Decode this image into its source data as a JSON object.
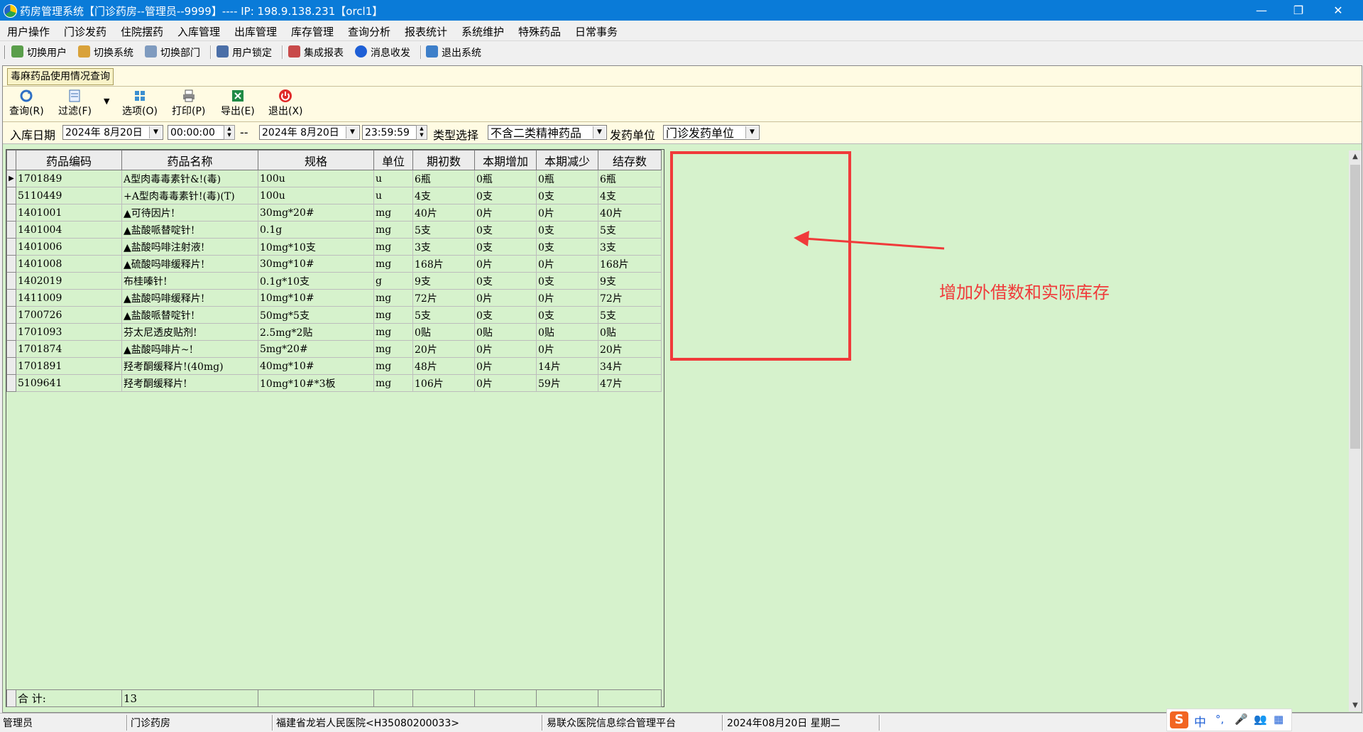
{
  "window": {
    "title": "药房管理系统【门诊药房--管理员--9999】---- IP: 198.9.138.231【orcl1】",
    "minimize": "—",
    "restore": "❐",
    "close": "✕"
  },
  "menu": [
    "用户操作",
    "门诊发药",
    "住院摆药",
    "入库管理",
    "出库管理",
    "库存管理",
    "查询分析",
    "报表统计",
    "系统维护",
    "特殊药品",
    "日常事务"
  ],
  "toolbar": [
    "切换用户",
    "切换系统",
    "切换部门",
    "用户锁定",
    "集成报表",
    "消息收发",
    "退出系统"
  ],
  "tab": {
    "label": "毒麻药品使用情况查询"
  },
  "actions": [
    "查询(R)",
    "过滤(F)",
    "选项(O)",
    "打印(P)",
    "导出(E)",
    "退出(X)"
  ],
  "filter": {
    "date_label": "入库日期",
    "start_date": "2024年 8月20日",
    "start_time": "00:00:00",
    "separator": "--",
    "end_date": "2024年 8月20日",
    "end_time": "23:59:59",
    "type_label": "类型选择",
    "type_value": "不含二类精神药品",
    "unit_label": "发药单位",
    "unit_value": "门诊发药单位"
  },
  "table": {
    "columns": [
      "药品编码",
      "药品名称",
      "规格",
      "单位",
      "期初数",
      "本期增加",
      "本期减少",
      "结存数"
    ],
    "rows": [
      [
        "1701849",
        "A型肉毒毒素针&!(毒)",
        "100u",
        "u",
        "6瓶",
        "0瓶",
        "0瓶",
        "6瓶"
      ],
      [
        "5110449",
        "+A型肉毒毒素针!(毒)(T)",
        "100u",
        "u",
        "4支",
        "0支",
        "0支",
        "4支"
      ],
      [
        "1401001",
        "▲可待因片!",
        "30mg*20#",
        "mg",
        "40片",
        "0片",
        "0片",
        "40片"
      ],
      [
        "1401004",
        "▲盐酸哌替啶针!",
        "0.1g",
        "mg",
        "5支",
        "0支",
        "0支",
        "5支"
      ],
      [
        "1401006",
        "▲盐酸吗啡注射液!",
        "10mg*10支",
        "mg",
        "3支",
        "0支",
        "0支",
        "3支"
      ],
      [
        "1401008",
        "▲硫酸吗啡缓释片!",
        "30mg*10#",
        "mg",
        "168片",
        "0片",
        "0片",
        "168片"
      ],
      [
        "1402019",
        "布桂嗪针!",
        "0.1g*10支",
        "g",
        "9支",
        "0支",
        "0支",
        "9支"
      ],
      [
        "1411009",
        "▲盐酸吗啡缓释片!",
        "10mg*10#",
        "mg",
        "72片",
        "0片",
        "0片",
        "72片"
      ],
      [
        "1700726",
        "▲盐酸哌替啶针!",
        "50mg*5支",
        "mg",
        "5支",
        "0支",
        "0支",
        "5支"
      ],
      [
        "1701093",
        "芬太尼透皮贴剂!",
        "2.5mg*2贴",
        "mg",
        "0贴",
        "0贴",
        "0贴",
        "0贴"
      ],
      [
        "1701874",
        "▲盐酸吗啡片~!",
        "5mg*20#",
        "mg",
        "20片",
        "0片",
        "0片",
        "20片"
      ],
      [
        "1701891",
        "羟考酮缓释片!(40mg)",
        "40mg*10#",
        "mg",
        "48片",
        "0片",
        "14片",
        "34片"
      ],
      [
        "5109641",
        "羟考酮缓释片!",
        "10mg*10#*3板",
        "mg",
        "106片",
        "0片",
        "59片",
        "47片"
      ]
    ],
    "summary_label": "合  计:",
    "summary_count": "13"
  },
  "annotation": {
    "text": "增加外借数和实际库存",
    "color": "#f03a3a"
  },
  "status": [
    "管理员",
    "门诊药房",
    "福建省龙岩人民医院<H35080200033>",
    "易联众医院信息综合管理平台",
    "2024年08月20日 星期二"
  ],
  "ime": {
    "logo": "S",
    "mode": "中"
  },
  "colors": {
    "titlebar": "#0a7bd8",
    "grid_bg": "#d6f2cc",
    "toolbar_bg": "#fffbe3",
    "annotation": "#f03a3a"
  }
}
